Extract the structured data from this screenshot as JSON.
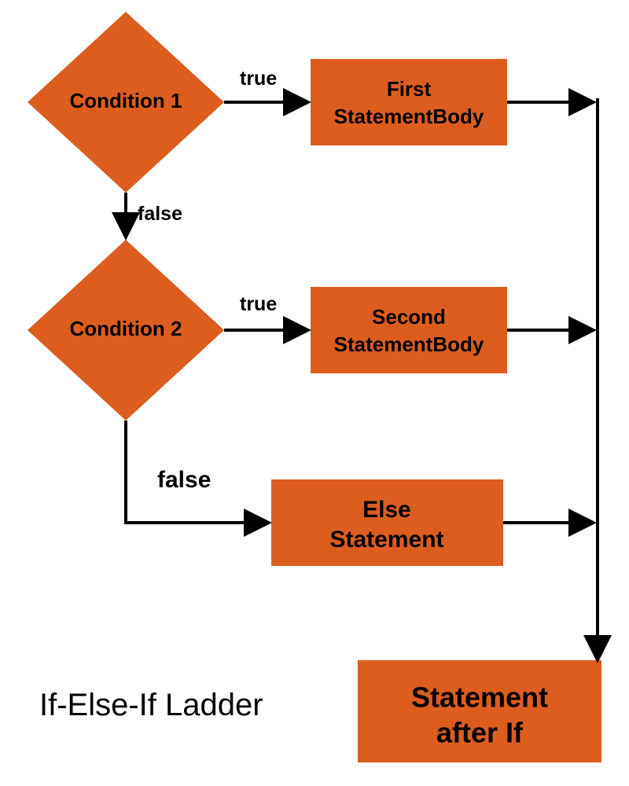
{
  "nodes": {
    "c1": "Condition 1",
    "c2": "Condition 2",
    "b1a": "First",
    "b1b": "StatementBody",
    "b2a": "Second",
    "b2b": "StatementBody",
    "elsea": "Else",
    "elseb": "Statement",
    "finala": "Statement",
    "finalb": "after If"
  },
  "labels": {
    "true": "true",
    "false": "false"
  },
  "title": "If-Else-If Ladder"
}
